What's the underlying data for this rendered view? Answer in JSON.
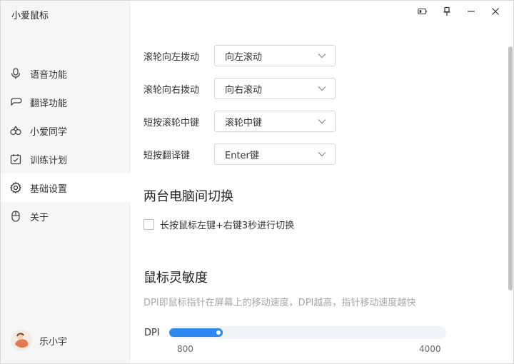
{
  "app": {
    "title": "小爱鼠标"
  },
  "window_controls": [
    {
      "name": "battery-icon"
    },
    {
      "name": "pin-icon"
    },
    {
      "name": "minimize-icon"
    },
    {
      "name": "close-icon"
    }
  ],
  "sidebar": {
    "items": [
      {
        "label": "语音功能",
        "icon": "microphone-icon",
        "active": false
      },
      {
        "label": "翻译功能",
        "icon": "translate-chat-icon",
        "active": false
      },
      {
        "label": "小爱同学",
        "icon": "xiaoai-icon",
        "active": false
      },
      {
        "label": "训练计划",
        "icon": "calendar-check-icon",
        "active": false
      },
      {
        "label": "基础设置",
        "icon": "gear-icon",
        "active": true
      },
      {
        "label": "关于",
        "icon": "mouse-icon",
        "active": false
      }
    ],
    "user": {
      "name": "乐小宇"
    }
  },
  "settings": {
    "rows": [
      {
        "label": "滚轮向左拨动",
        "value": "向左滚动"
      },
      {
        "label": "滚轮向右拨动",
        "value": "向右滚动"
      },
      {
        "label": "短按滚轮中键",
        "value": "滚轮中键"
      },
      {
        "label": "短按翻译键",
        "value": "Enter键"
      }
    ],
    "switch_section": {
      "title": "两台电脑间切换",
      "checkbox_label": "长按鼠标左键+右键3秒进行切换",
      "checked": false
    },
    "sensitivity": {
      "title": "鼠标灵敏度",
      "description": "DPI即鼠标指针在屏幕上的移动速度，DPI越高，指针移动速度越快",
      "dpi_label": "DPI",
      "min_label": "800",
      "max_label": "4000",
      "min": 800,
      "max": 4000,
      "value": 1600,
      "accent_color": "#2f87f0"
    }
  }
}
